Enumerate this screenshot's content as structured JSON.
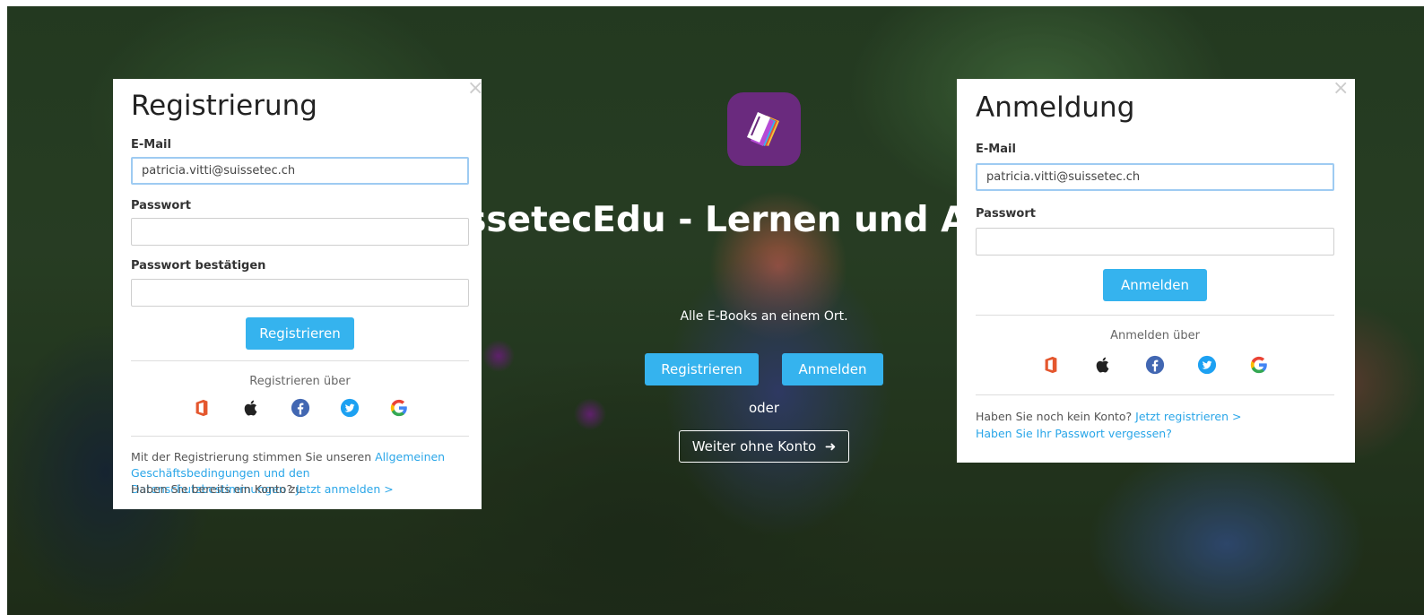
{
  "hero": {
    "title": "SuissetecEdu - Lernen und Arbeiten",
    "tagline": "Alle E-Books an einem Ort.",
    "register_label": "Registrieren",
    "login_label": "Anmelden",
    "or_label": "oder",
    "guest_label": "Weiter ohne Konto"
  },
  "register_modal": {
    "close": "×",
    "title": "Registrierung",
    "email_label": "E-Mail",
    "email_value": "patricia.vitti@suissetec.ch",
    "password_label": "Passwort",
    "password_value": "",
    "confirm_label": "Passwort bestätigen",
    "confirm_value": "",
    "submit_label": "Registrieren",
    "social_caption": "Registrieren über",
    "terms_prefix": "Mit der Registrierung stimmen Sie unseren ",
    "terms_link": "Allgemeinen Geschäftsbedingungen und den Datenschutzbestimmungen",
    "terms_suffix": " zu.",
    "account_prompt": "Haben Sie bereits ein Konto?",
    "login_link": "Jetzt anmelden >"
  },
  "login_modal": {
    "close": "×",
    "title": "Anmeldung",
    "email_label": "E-Mail",
    "email_value": "patricia.vitti@suissetec.ch",
    "password_label": "Passwort",
    "password_value": "",
    "submit_label": "Anmelden",
    "social_caption": "Anmelden über",
    "no_account_prompt": "Haben Sie noch kein Konto?",
    "register_link": "Jetzt registrieren >",
    "forgot_link": "Haben Sie Ihr Passwort vergessen?"
  },
  "social_icons": [
    "office-icon",
    "apple-icon",
    "facebook-icon",
    "twitter-icon",
    "google-icon"
  ],
  "colors": {
    "accent": "#35b3ee",
    "link": "#2aa6e8",
    "logo_bg": "#6a2a7e",
    "facebook": "#3b5998",
    "twitter": "#1da1f2",
    "office": "#e4572e"
  }
}
